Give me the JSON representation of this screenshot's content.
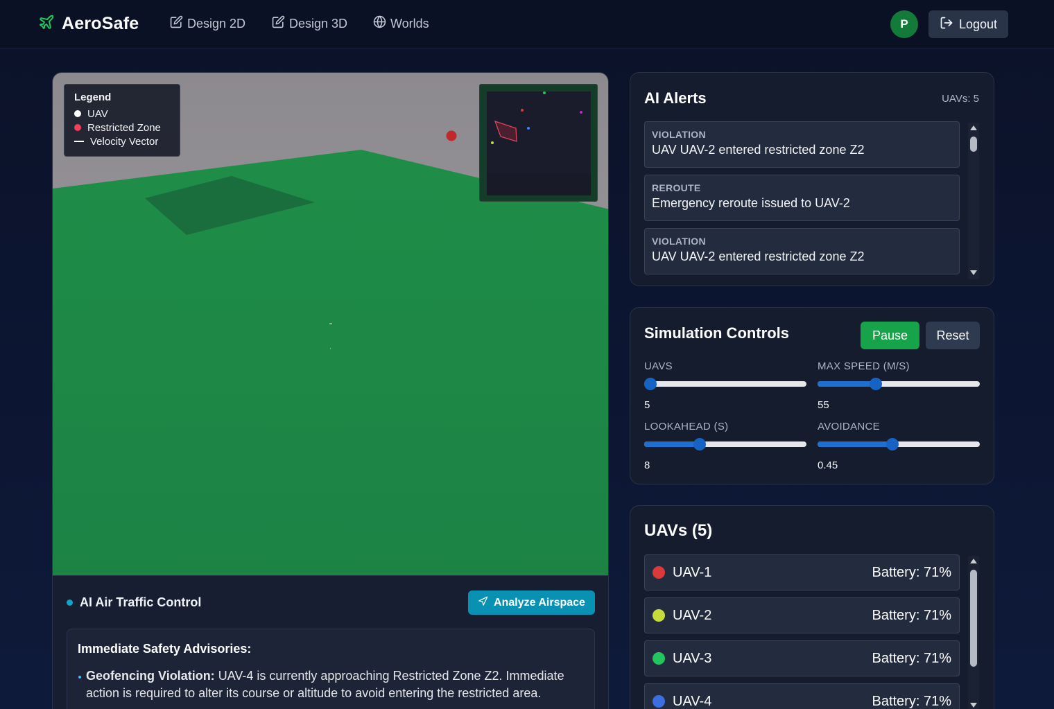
{
  "header": {
    "brand": "AeroSafe",
    "nav": [
      {
        "label": "Design 2D",
        "icon": "edit-icon"
      },
      {
        "label": "Design 3D",
        "icon": "edit-icon"
      },
      {
        "label": "Worlds",
        "icon": "globe-icon"
      }
    ],
    "avatar_initial": "P",
    "logout_label": "Logout"
  },
  "viewport": {
    "legend": {
      "title": "Legend",
      "items": [
        {
          "label": "UAV",
          "color": "#ffffff"
        },
        {
          "label": "Restricted Zone",
          "color": "#f43f5e"
        },
        {
          "label": "Velocity Vector",
          "color": "#ffffff"
        }
      ]
    }
  },
  "atc": {
    "title": "AI Air Traffic Control",
    "analyze_label": "Analyze Airspace",
    "advisory_title": "Immediate Safety Advisories:",
    "advisory_bold": "Geofencing Violation:",
    "advisory_text": " UAV-4 is currently approaching Restricted Zone Z2. Immediate action is required to alter its course or altitude to avoid entering the restricted area."
  },
  "alerts": {
    "title": "AI Alerts",
    "count_label": "UAVs: 5",
    "items": [
      {
        "type": "VIOLATION",
        "message": "UAV UAV-2 entered restricted zone Z2"
      },
      {
        "type": "REROUTE",
        "message": "Emergency reroute issued to UAV-2"
      },
      {
        "type": "VIOLATION",
        "message": "UAV UAV-2 entered restricted zone Z2"
      }
    ]
  },
  "simulation": {
    "title": "Simulation Controls",
    "pause_label": "Pause",
    "reset_label": "Reset",
    "controls": [
      {
        "label": "UAVS",
        "value": "5",
        "fraction": 0.04
      },
      {
        "label": "MAX SPEED (M/S)",
        "value": "55",
        "fraction": 0.36
      },
      {
        "label": "LOOKAHEAD (S)",
        "value": "8",
        "fraction": 0.34
      },
      {
        "label": "AVOIDANCE",
        "value": "0.45",
        "fraction": 0.46
      }
    ]
  },
  "uavs": {
    "title": "UAVs (5)",
    "items": [
      {
        "name": "UAV-1",
        "battery": "Battery: 71%",
        "color": "#dc3a3a"
      },
      {
        "name": "UAV-2",
        "battery": "Battery: 71%",
        "color": "#c6dc3a"
      },
      {
        "name": "UAV-3",
        "battery": "Battery: 71%",
        "color": "#22c55e"
      },
      {
        "name": "UAV-4",
        "battery": "Battery: 71%",
        "color": "#3b6fe0"
      }
    ]
  },
  "colors": {
    "accent_green": "#16a34a",
    "accent_cyan": "#0891b2",
    "slider_blue": "#1f6fd1"
  }
}
